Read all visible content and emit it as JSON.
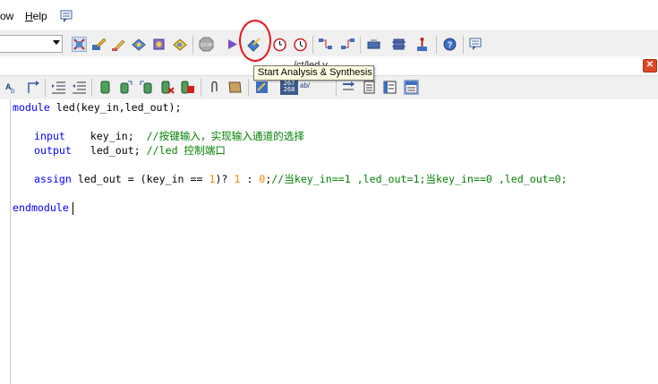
{
  "menubar": {
    "items": [
      "ow",
      "Help"
    ]
  },
  "toolbar": {
    "combo_value": "",
    "icons": [
      "stop-icon",
      "run-icon",
      "start-analysis-synthesis-icon",
      "timer-icon",
      "timer-icon-2",
      "netlist-viewer-icon",
      "rtl-viewer-icon",
      "programmer-icon",
      "chip-planner-icon",
      "pin-planner-icon",
      "help-icon",
      "feedback-icon"
    ]
  },
  "tooltip": "Start Analysis & Synthesis",
  "tab": {
    "label": "/ct/led.v",
    "close": "✕"
  },
  "editor_toolbar": {
    "number_icon_text": "267\n268",
    "ab_text": "ab/"
  },
  "code": {
    "line1": {
      "kw": "module",
      "rest": " led(key_in,led_out);"
    },
    "line2": {
      "kw": "input",
      "pad": "    ",
      "ident": "key_in;",
      "comment": "  //按键输入，实现输入通道的选择"
    },
    "line3": {
      "kw": "output",
      "pad": "   ",
      "ident": "led_out;",
      "comment": " //led 控制端口"
    },
    "line4": {
      "kw": "assign",
      "mid": " led_out = (key_in == ",
      "n1": "1",
      "q": ")? ",
      "n2": "1",
      "colon": " : ",
      "n3": "0",
      "semi": ";",
      "comment": "//当key_in==1 ,led_out=1;当key_in==0 ,led_out=0;"
    },
    "line5": {
      "kw": "endmodule"
    }
  }
}
